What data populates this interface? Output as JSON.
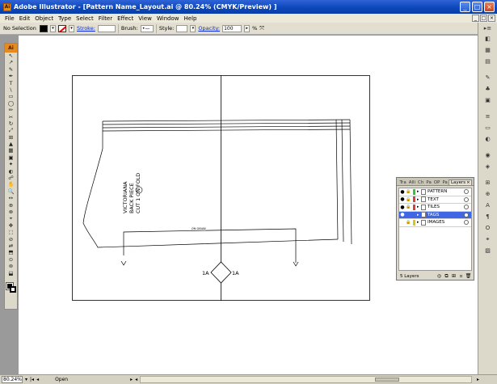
{
  "window": {
    "title": "Adobe Illustrator - [Pattern Name_Layout.ai @ 80.24% (CMYK/Preview) ]",
    "minimize": "_",
    "maximize": "□",
    "close": "×"
  },
  "menu": [
    "File",
    "Edit",
    "Object",
    "Type",
    "Select",
    "Filter",
    "Effect",
    "View",
    "Window",
    "Help"
  ],
  "control_bar": {
    "selection": "No Selection",
    "stroke_label": "Stroke:",
    "brush_label": "Brush:",
    "style_label": "Style:",
    "opacity_label": "Opacity:",
    "opacity_value": "100",
    "opacity_unit": "%"
  },
  "toolbox": {
    "logo": "Ai",
    "tools": [
      "↖",
      "↗",
      "✎",
      "✒",
      "T",
      "\\",
      "▭",
      "◯",
      "✏",
      "✂",
      "↻",
      "⤢",
      "⊞",
      "▲",
      "▦",
      "▣",
      "✦",
      "◐",
      "☍",
      "✋",
      "🔍",
      "↔",
      "⊕",
      "⊗",
      "⌖",
      "✥",
      "⬚",
      "⊘",
      "⇄",
      "⬒",
      "⊙",
      "⊚",
      "⬓"
    ]
  },
  "artboard": {
    "pattern_text": [
      "VICTORIANA",
      "BACK PIECE",
      "CUT  1  ON FOLD"
    ],
    "grainline_label": "ON GRAIN",
    "notch_left": "1A",
    "notch_right": "1A"
  },
  "layers_panel": {
    "tabs": [
      "Tra",
      "Alli",
      "Ch",
      "Pa",
      "OP",
      "Pa",
      "Layers"
    ],
    "active_tab": "Layers",
    "tab_close": "×",
    "layers": [
      {
        "name": "PATTERN",
        "color": "#3fbf3f",
        "visible": true,
        "locked": true,
        "selected": false
      },
      {
        "name": "TEXT",
        "color": "#e03a3a",
        "visible": true,
        "locked": true,
        "selected": false
      },
      {
        "name": "TILES",
        "color": "#e03a3a",
        "visible": true,
        "locked": true,
        "selected": false
      },
      {
        "name": "TAGS",
        "color": "#3f66e3",
        "visible": true,
        "locked": false,
        "selected": true
      },
      {
        "name": "IMAGES",
        "color": "#e0c020",
        "visible": false,
        "locked": true,
        "selected": false
      }
    ],
    "count": "5 Layers"
  },
  "status_bar": {
    "zoom": "80.24%",
    "status": "Open"
  },
  "colors": {
    "titlebar": "#0b46b8",
    "selected_layer": "#3f66e3",
    "chrome": "#dcd9ca"
  }
}
